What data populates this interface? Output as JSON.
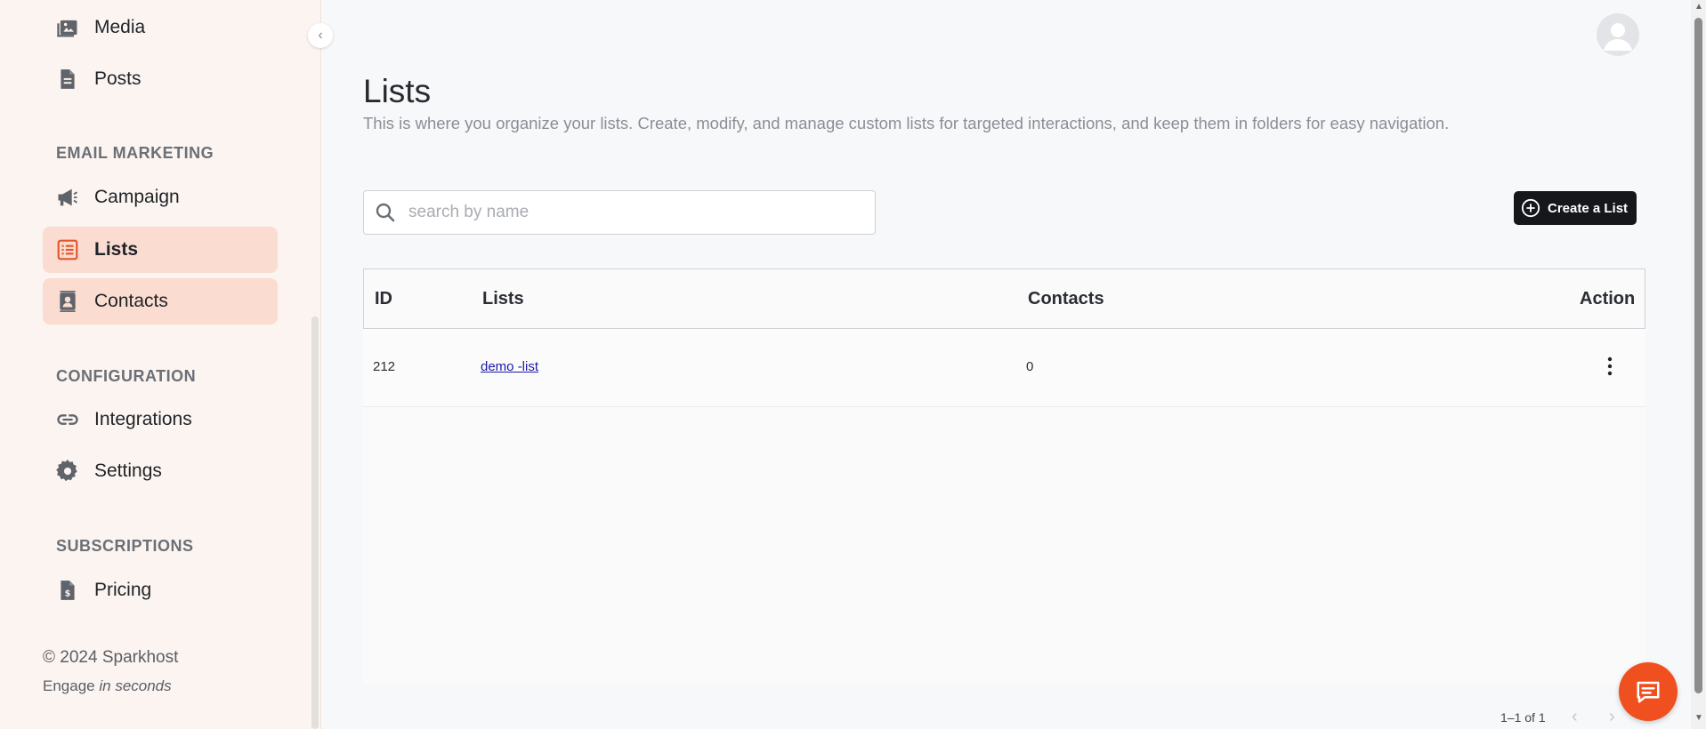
{
  "sidebar": {
    "items": [
      {
        "label": "Media",
        "icon": "media-icon"
      },
      {
        "label": "Posts",
        "icon": "document-icon"
      },
      {
        "label": "Campaign",
        "icon": "megaphone-icon"
      },
      {
        "label": "Lists",
        "icon": "list-icon",
        "active": true
      },
      {
        "label": "Contacts",
        "icon": "contacts-icon",
        "active": true
      },
      {
        "label": "Integrations",
        "icon": "link-icon"
      },
      {
        "label": "Settings",
        "icon": "gear-icon"
      },
      {
        "label": "Pricing",
        "icon": "invoice-icon"
      }
    ],
    "sections": {
      "email_marketing": "EMAIL MARKETING",
      "configuration": "CONFIGURATION",
      "subscriptions": "SUBSCRIPTIONS"
    },
    "footer": {
      "copyright": "© 2024 Sparkhost",
      "tagline_prefix": "Engage",
      "tagline_emphasis": "in seconds"
    }
  },
  "header": {
    "title": "Lists",
    "description": "This is where you organize your lists. Create, modify, and manage custom lists for targeted interactions, and keep them in folders for easy navigation."
  },
  "toolbar": {
    "search_placeholder": "search by name",
    "search_value": "",
    "create_label": "Create a List"
  },
  "table": {
    "columns": [
      "ID",
      "Lists",
      "Contacts",
      "Action"
    ],
    "rows": [
      {
        "id": "212",
        "name": "demo -list",
        "contacts": "0"
      }
    ]
  },
  "pagination": {
    "summary": "1–1 of 1"
  },
  "colors": {
    "accent": "#f0501f",
    "active_nav_bg": "#fbdcd1",
    "primary_button": "#15171a",
    "link": "#1a1aa8"
  }
}
